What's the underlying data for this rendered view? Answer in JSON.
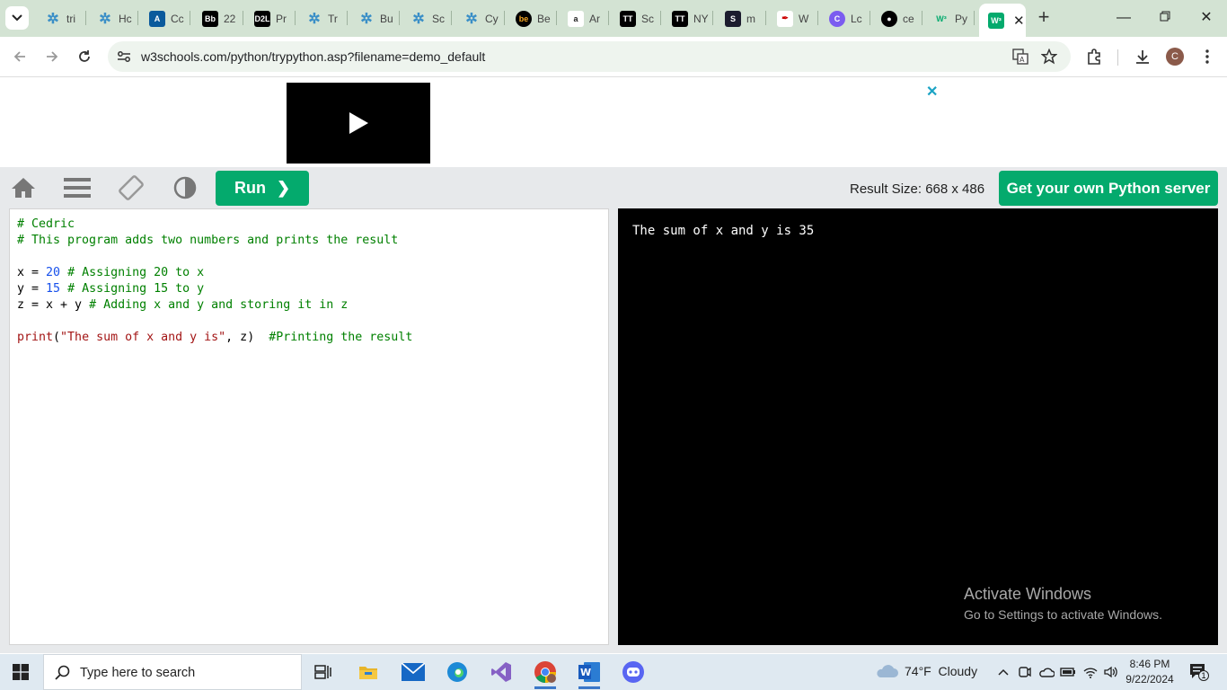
{
  "browser": {
    "tabs": [
      {
        "title": "tri",
        "icon": "puzzle-icon",
        "color": "#3a8fc7"
      },
      {
        "title": "Hc",
        "icon": "puzzle-icon",
        "color": "#3a8fc7"
      },
      {
        "title": "Cc",
        "icon": "a-logo-icon",
        "color": "#0a5a9c"
      },
      {
        "title": "22",
        "icon": "bb-icon",
        "color": "#000000"
      },
      {
        "title": "Pr",
        "icon": "d2l-icon",
        "color": "#000000"
      },
      {
        "title": "Tr",
        "icon": "puzzle-icon",
        "color": "#3a8fc7"
      },
      {
        "title": "Bu",
        "icon": "puzzle-icon",
        "color": "#3a8fc7"
      },
      {
        "title": "Sc",
        "icon": "puzzle-icon",
        "color": "#3a8fc7"
      },
      {
        "title": "Cy",
        "icon": "puzzle-icon",
        "color": "#3a8fc7"
      },
      {
        "title": "Be",
        "icon": "be-icon",
        "color": "#000000"
      },
      {
        "title": "Ar",
        "icon": "amazon-icon",
        "color": "#ffffff"
      },
      {
        "title": "Sc",
        "icon": "tt-icon",
        "color": "#000000"
      },
      {
        "title": "NY",
        "icon": "tt-icon",
        "color": "#000000"
      },
      {
        "title": "m",
        "icon": "s-icon",
        "color": "#1c1c2e"
      },
      {
        "title": "W",
        "icon": "feather-icon",
        "color": "#ffffff"
      },
      {
        "title": "Lc",
        "icon": "c-logo-icon",
        "color": "#7b5cf0"
      },
      {
        "title": "ce",
        "icon": "github-icon",
        "color": "#000000"
      },
      {
        "title": "Py",
        "icon": "w3-icon",
        "color": "#04aa6d"
      }
    ],
    "active_tab": {
      "title": "W",
      "icon": "w3-icon"
    },
    "active_tab_close": "✕",
    "url": "w3schools.com/python/trypython.asp?filename=demo_default",
    "profile_initial": "C"
  },
  "ad": {
    "close": "✕"
  },
  "tryit": {
    "run_label": "Run",
    "run_arrow": "❯",
    "result_size": "Result Size: 668 x 486",
    "get_server": "Get your own Python server"
  },
  "editor": {
    "lines": [
      "# Cedric",
      "# This program adds two numbers and prints the result",
      "",
      "x = 20 # Assigning 20 to x",
      "y = 15 # Assigning 15 to y",
      "z = x + y # Adding x and y and storing it in z",
      "",
      "print(\"The sum of x and y is\", z)  #Printing the result"
    ]
  },
  "output": {
    "text": "The sum of x and y is 35"
  },
  "watermark": {
    "line1": "Activate Windows",
    "line2": "Go to Settings to activate Windows."
  },
  "taskbar": {
    "search_placeholder": "Type here to search",
    "weather": "74°F  Cloudy",
    "time": "8:46 PM",
    "date": "9/22/2024",
    "notifications": "1"
  }
}
